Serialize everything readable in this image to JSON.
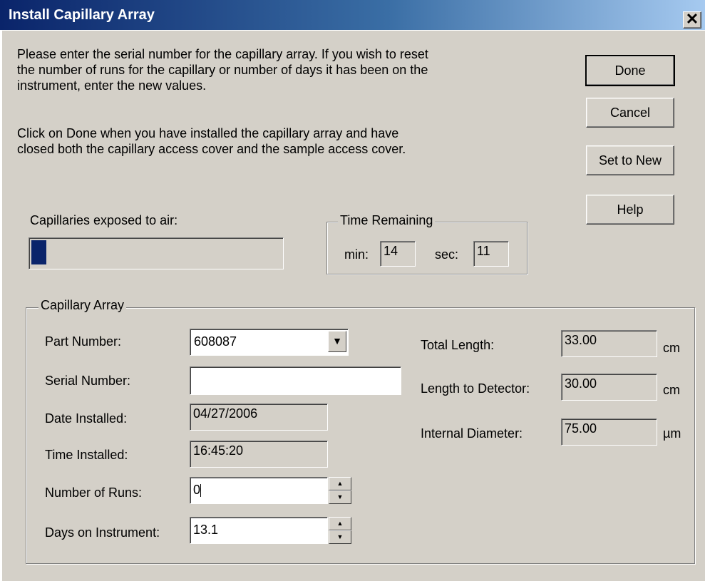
{
  "window": {
    "title": "Install Capillary Array",
    "close_glyph": "✕"
  },
  "instructions": {
    "para1_line1": "Please enter the serial number for the capillary array. If you wish to reset",
    "para1_line2": "the number of runs for the capillary or number of days it has been on the",
    "para1_line3": "instrument, enter the new values.",
    "para2_line1": "Click on Done when you have installed the capillary array and have",
    "para2_line2": "closed both the capillary access cover and the sample access cover."
  },
  "buttons": {
    "done": "Done",
    "cancel": "Cancel",
    "set_to_new": "Set to New",
    "help": "Help"
  },
  "exposure": {
    "label": "Capillaries exposed to air:",
    "progress_fraction": 0.06,
    "progress_color": "#0a246a"
  },
  "time_remaining": {
    "title": "Time Remaining",
    "min_label": "min:",
    "min_value": "14",
    "sec_label": "sec:",
    "sec_value": "11"
  },
  "capillary_array": {
    "title": "Capillary Array",
    "part_number": {
      "label": "Part Number:",
      "value": "608087"
    },
    "serial_number": {
      "label": "Serial Number:",
      "value": ""
    },
    "date_installed": {
      "label": "Date Installed:",
      "value": "04/27/2006"
    },
    "time_installed": {
      "label": "Time Installed:",
      "value": "16:45:20"
    },
    "number_of_runs": {
      "label": "Number of Runs:",
      "value": "0"
    },
    "days_on_instrument": {
      "label": "Days on Instrument:",
      "value": "13.1"
    },
    "total_length": {
      "label": "Total Length:",
      "value": "33.00",
      "unit": "cm"
    },
    "length_to_detector": {
      "label": "Length to Detector:",
      "value": "30.00",
      "unit": "cm"
    },
    "internal_diameter": {
      "label": "Internal Diameter:",
      "value": "75.00",
      "unit": "µm"
    }
  },
  "icons": {
    "dropdown": "▼",
    "spin_up": "▲",
    "spin_down": "▼"
  }
}
